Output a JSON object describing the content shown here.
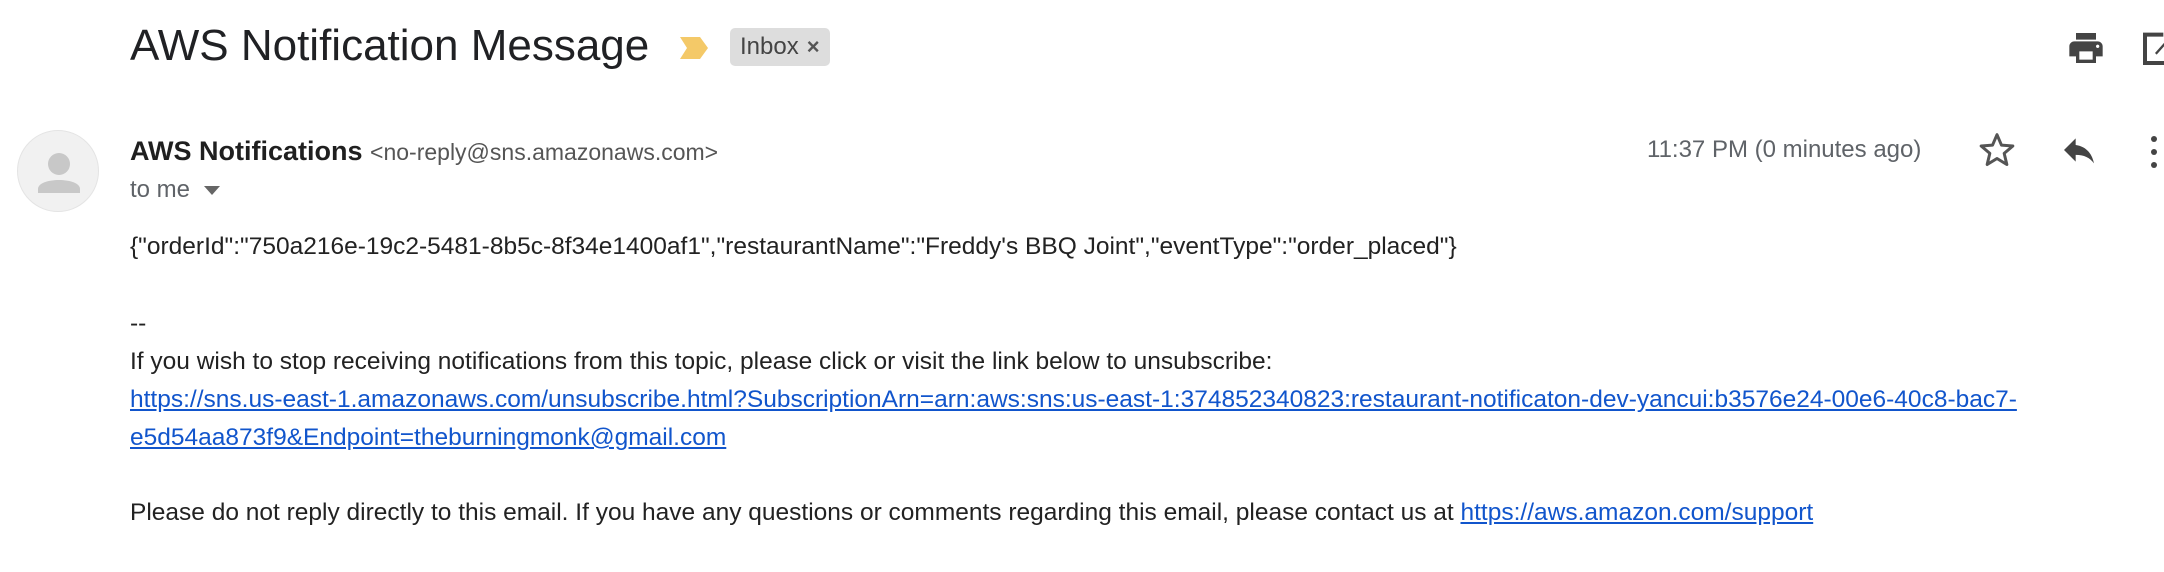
{
  "email": {
    "subject": "AWS Notification Message",
    "label": "Inbox",
    "label_remove_glyph": "×",
    "sender_name": "AWS Notifications",
    "sender_email": "<no-reply@sns.amazonaws.com>",
    "recipient": "to me",
    "timestamp": "11:37 PM (0 minutes ago)",
    "body": {
      "json_line": "{\"orderId\":\"750a216e-19c2-5481-8b5c-8f34e1400af1\",\"restaurantName\":\"Freddy's BBQ Joint\",\"eventType\":\"order_placed\"}",
      "separator": "--",
      "unsubscribe_intro": "If you wish to stop receiving notifications from this topic, please click or visit the link below to unsubscribe:",
      "unsubscribe_link_line1": "https://sns.us-east-1.amazonaws.com/unsubscribe.html?SubscriptionArn=arn:aws:sns:us-east-1:374852340823:restaurant-notificaton-dev-yancui:b3576e24-00e6-40c8-bac7-",
      "unsubscribe_link_line2": "e5d54aa873f9&Endpoint=theburningmonk@gmail.com",
      "footer_text": "Please do not reply directly to this email. If you have any questions or comments regarding this email, please contact us at ",
      "support_link": "https://aws.amazon.com/support"
    }
  },
  "icons": {
    "importance": "importance-marker-icon",
    "print": "print-icon",
    "popout": "open-in-new-window-icon",
    "avatar": "default-avatar-icon",
    "star": "star-icon",
    "reply": "reply-icon",
    "more": "more-vert-icon",
    "caret": "chevron-down-icon"
  },
  "colors": {
    "importance": "#f4c968",
    "link": "#1155cc",
    "label_bg": "#dddddd",
    "icon": "#444444"
  }
}
